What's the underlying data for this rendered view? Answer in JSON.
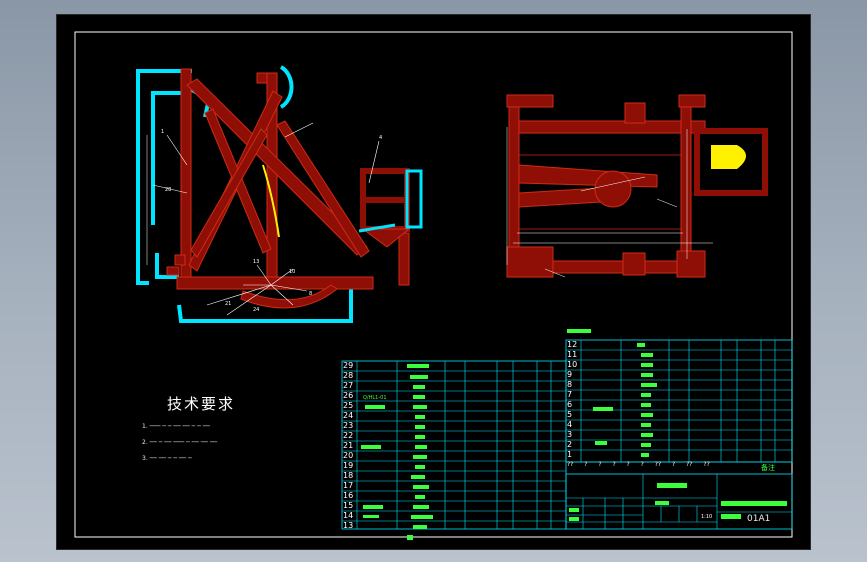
{
  "technical_requirements": {
    "title": "技术要求"
  },
  "parts_list_left": {
    "row_numbers": [
      "29",
      "28",
      "27",
      "26",
      "25",
      "24",
      "23",
      "22",
      "21",
      "20",
      "19",
      "18",
      "17",
      "16",
      "15",
      "14",
      "13"
    ],
    "header_code": "Q/HL1-01"
  },
  "parts_list_right": {
    "row_numbers": [
      "12",
      "11",
      "10",
      "9",
      "8",
      "7",
      "6",
      "5",
      "4",
      "3",
      "2",
      "1"
    ],
    "bottom_row_marks": [
      "??",
      "?",
      "?",
      "?",
      "?",
      "?",
      "??",
      "?",
      "??",
      "??"
    ],
    "header_label": "备注"
  },
  "title_block": {
    "drawing_number": "01A1",
    "scale": "1:10"
  },
  "colors": {
    "background": "#000000",
    "frame": "#ffffff",
    "part_body": "#8f0f06",
    "part_outline": "#d02a14",
    "cyan": "#00e5ff",
    "table_lines": "#00e5ff",
    "text_green": "#3bff3b",
    "highlight_yellow": "#fff100"
  }
}
